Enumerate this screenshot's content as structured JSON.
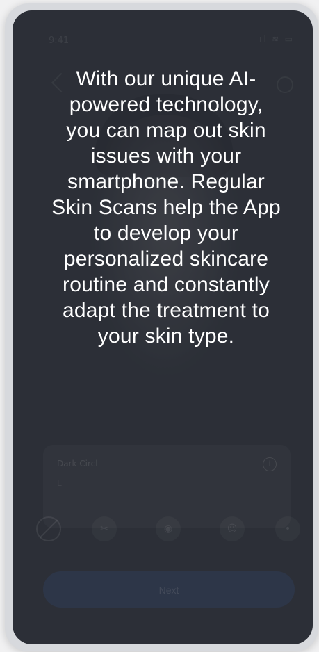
{
  "status_bar": {
    "time": "9:41",
    "icons": " ıl ≋ ▭"
  },
  "card": {
    "label": "Dark Circl",
    "sub": "L"
  },
  "tools": {
    "no_icon": "",
    "tool_2": "✂",
    "tool_3": "◉",
    "tool_4": "☺",
    "tool_5": "•"
  },
  "next_button": {
    "label": "Next"
  },
  "info_icon": "i",
  "overlay": {
    "text": "With our unique AI-powered technology, you can map out skin issues with your smartphone. Regular Skin Scans help the App to develop your personalized skincare routine and constantly adapt the treatment to your skin type."
  },
  "colors": {
    "screen_bg": "#2e3239",
    "overlay_text": "#ffffff",
    "next_button": "#3a5696"
  }
}
